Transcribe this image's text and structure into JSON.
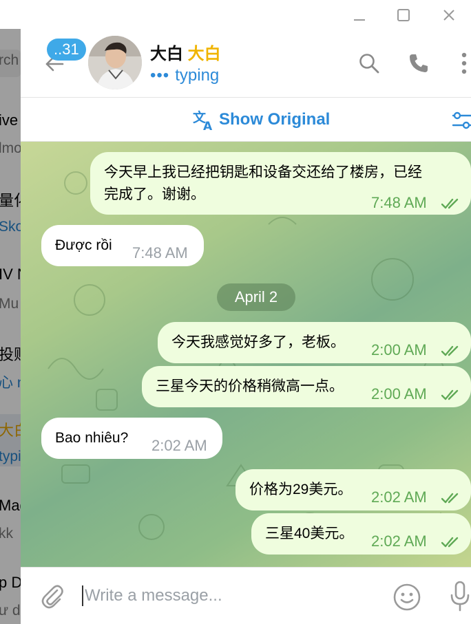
{
  "window": {
    "minimize": "—",
    "maximize": "☐",
    "close": "✕"
  },
  "chat_list_partial": [
    {
      "line1": "rch",
      "line2": ""
    },
    {
      "line1": "ive",
      "line2": "lmo"
    },
    {
      "line1": "量化",
      "line2": "Sko"
    },
    {
      "line1": "IV N",
      "line2": "Mu"
    },
    {
      "line1": "投财",
      "line2": "心 n"
    },
    {
      "line1": "大白",
      "line2": "typi"
    },
    {
      "line1": "Mag",
      "line2": "kk"
    },
    {
      "line1": "p D",
      "line2": "ư d"
    }
  ],
  "header": {
    "unread_badge": "..31",
    "contact_name": "大白",
    "contact_name_emoji": "大白",
    "status_dots": "•••",
    "status": "typing"
  },
  "translate_bar": {
    "label": "Show Original"
  },
  "date_separator": "April 2",
  "messages": [
    {
      "id": "m1",
      "direction": "out",
      "lines": [
        "今天早上我已经把钥匙和设备交还给了楼房，已经",
        "完成了。谢谢。"
      ],
      "time": "7:48 AM",
      "read": true
    },
    {
      "id": "m2",
      "direction": "in",
      "lines": [
        "Được rồi"
      ],
      "time": "7:48 AM"
    },
    {
      "id": "m3",
      "direction": "out",
      "lines": [
        "今天我感觉好多了，老板。"
      ],
      "time": "2:00 AM",
      "read": true
    },
    {
      "id": "m4",
      "direction": "out",
      "lines": [
        "三星今天的价格稍微高一点。"
      ],
      "time": "2:00 AM",
      "read": true
    },
    {
      "id": "m5",
      "direction": "in",
      "lines": [
        "Bao nhiêu?"
      ],
      "time": "2:02 AM"
    },
    {
      "id": "m6",
      "direction": "out",
      "lines": [
        "价格为29美元。"
      ],
      "time": "2:02 AM",
      "read": true
    },
    {
      "id": "m7",
      "direction": "out",
      "lines": [
        "三星40美元。"
      ],
      "time": "2:02 AM",
      "read": true
    }
  ],
  "composer": {
    "placeholder": "Write a message..."
  },
  "icons": {
    "back": "arrow-left-icon",
    "search": "search-icon",
    "call": "phone-icon",
    "more": "more-vertical-icon",
    "translate": "translate-icon",
    "translate_settings": "sliders-icon",
    "attach": "paperclip-icon",
    "emoji": "emoji-icon",
    "voice": "microphone-icon",
    "read_receipt": "double-check-icon"
  },
  "colors": {
    "accent": "#2c8ad8",
    "badge": "#3fa9e8",
    "outgoing_bubble": "#effdde",
    "incoming_bubble": "#ffffff",
    "outgoing_time": "#5fa955",
    "name_highlight": "#f0b400"
  }
}
